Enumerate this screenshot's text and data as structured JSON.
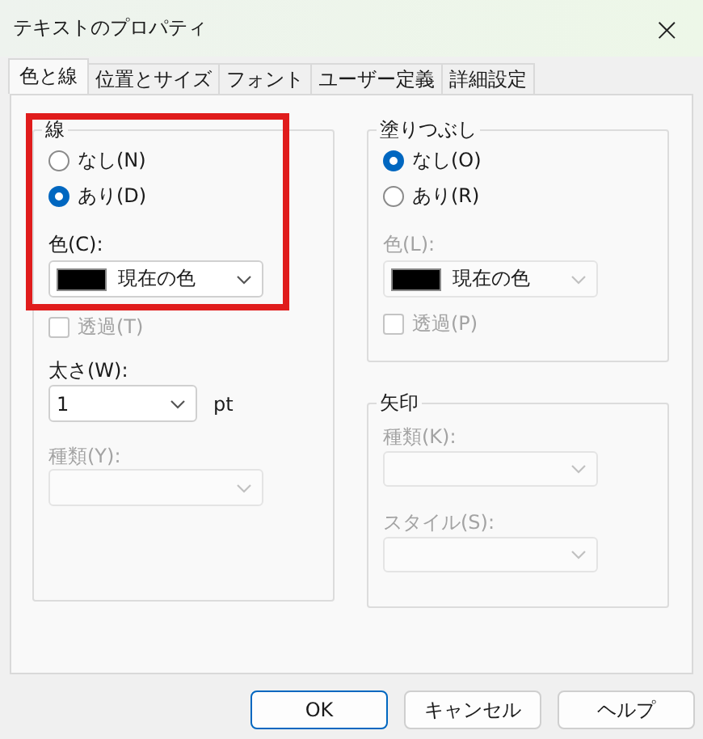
{
  "window": {
    "title": "テキストのプロパティ",
    "close": "×"
  },
  "tabs": [
    {
      "label": "色と線",
      "selected": true
    },
    {
      "label": "位置とサイズ",
      "selected": false
    },
    {
      "label": "フォント",
      "selected": false
    },
    {
      "label": "ユーザー定義",
      "selected": false
    },
    {
      "label": "詳細設定",
      "selected": false
    }
  ],
  "line_group": {
    "title": "線",
    "highlighted": true,
    "options": [
      {
        "label": "なし(N)",
        "selected": false
      },
      {
        "label": "あり(D)",
        "selected": true
      }
    ],
    "color_label": "色(C):",
    "color_value": "現在の色",
    "color_disabled": false,
    "transparency": {
      "label": "透過(T)",
      "checked": false,
      "disabled": true
    },
    "weight_label": "太さ(W):",
    "weight_value": "1",
    "weight_unit": "pt",
    "type_label": "種類(Y):",
    "type_disabled": true
  },
  "fill_group": {
    "title": "塗りつぶし",
    "options": [
      {
        "label": "なし(O)",
        "selected": true
      },
      {
        "label": "あり(R)",
        "selected": false
      }
    ],
    "color_label": "色(L):",
    "color_value": "現在の色",
    "color_disabled": true,
    "transparency": {
      "label": "透過(P)",
      "checked": false,
      "disabled": true
    }
  },
  "arrow_group": {
    "title": "矢印",
    "type_label": "種類(K):",
    "style_label": "スタイル(S):",
    "disabled": true
  },
  "buttons": [
    {
      "label": "OK",
      "default": true
    },
    {
      "label": "キャンセル",
      "default": false
    },
    {
      "label": "ヘルプ",
      "default": false
    }
  ]
}
